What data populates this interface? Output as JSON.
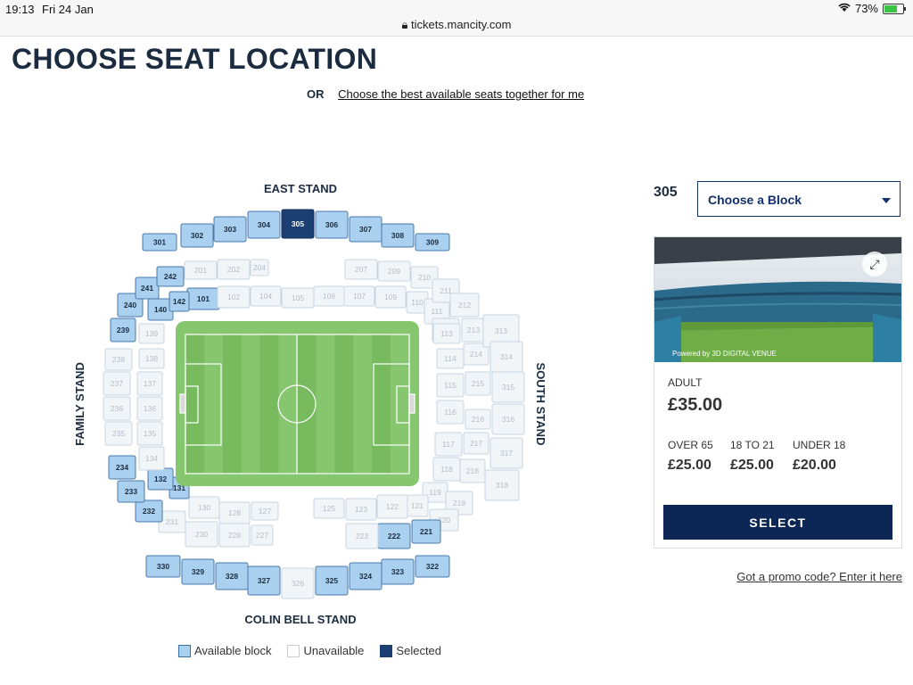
{
  "status": {
    "time": "19:13",
    "date": "Fri 24 Jan",
    "url": "tickets.mancity.com",
    "battery": "73%"
  },
  "page": {
    "title": "CHOOSE SEAT LOCATION",
    "or_label": "OR",
    "best_seats_link": "Choose the best available seats together for me"
  },
  "stands": {
    "east": "EAST STAND",
    "family": "FAMILY STAND",
    "south": "SOUTH STAND",
    "colin_bell": "COLIN BELL STAND"
  },
  "legend": {
    "available": "Available block",
    "unavailable": "Unavailable",
    "selected": "Selected"
  },
  "colors": {
    "available": "#a9d0ef",
    "unavailable": "#f2f5f8",
    "selected": "#1c3f73",
    "navy": "#0c2755",
    "pitch_light": "#86c66f",
    "pitch_dark": "#78bb5f"
  },
  "blocks": {
    "available": [
      "302",
      "303",
      "304",
      "306",
      "307",
      "308",
      "301",
      "309",
      "242",
      "241",
      "101",
      "142",
      "140",
      "240",
      "239",
      "234",
      "132",
      "233",
      "131",
      "232",
      "330",
      "329",
      "328",
      "327",
      "325",
      "324",
      "323",
      "322",
      "222",
      "221"
    ],
    "unavailable": [
      "201",
      "202",
      "204",
      "207",
      "209",
      "210",
      "211",
      "212",
      "213",
      "313",
      "105",
      "102",
      "104",
      "106",
      "107",
      "109",
      "110",
      "111",
      "112",
      "113",
      "114",
      "214",
      "314",
      "115",
      "215",
      "315",
      "116",
      "216",
      "316",
      "117",
      "217",
      "317",
      "118",
      "218",
      "318",
      "119",
      "219",
      "220",
      "121",
      "122",
      "123",
      "125",
      "127",
      "128",
      "130",
      "231",
      "230",
      "228",
      "227",
      "223",
      "326",
      "139",
      "138",
      "137",
      "136",
      "135",
      "134",
      "238",
      "237",
      "236",
      "235"
    ],
    "selected": [
      "305"
    ]
  },
  "sidebar": {
    "selected_block": "305",
    "choose_block": "Choose a Block",
    "photo_credit": "Powered by 3D DIGITAL VENUE",
    "adult_label": "ADULT",
    "adult_price": "£35.00",
    "over65_label": "OVER 65",
    "over65_price": "£25.00",
    "age18to21_label": "18 TO 21",
    "age18to21_price": "£25.00",
    "under18_label": "UNDER 18",
    "under18_price": "£20.00",
    "select_button": "SELECT",
    "promo_link": "Got a promo code? Enter it here"
  }
}
